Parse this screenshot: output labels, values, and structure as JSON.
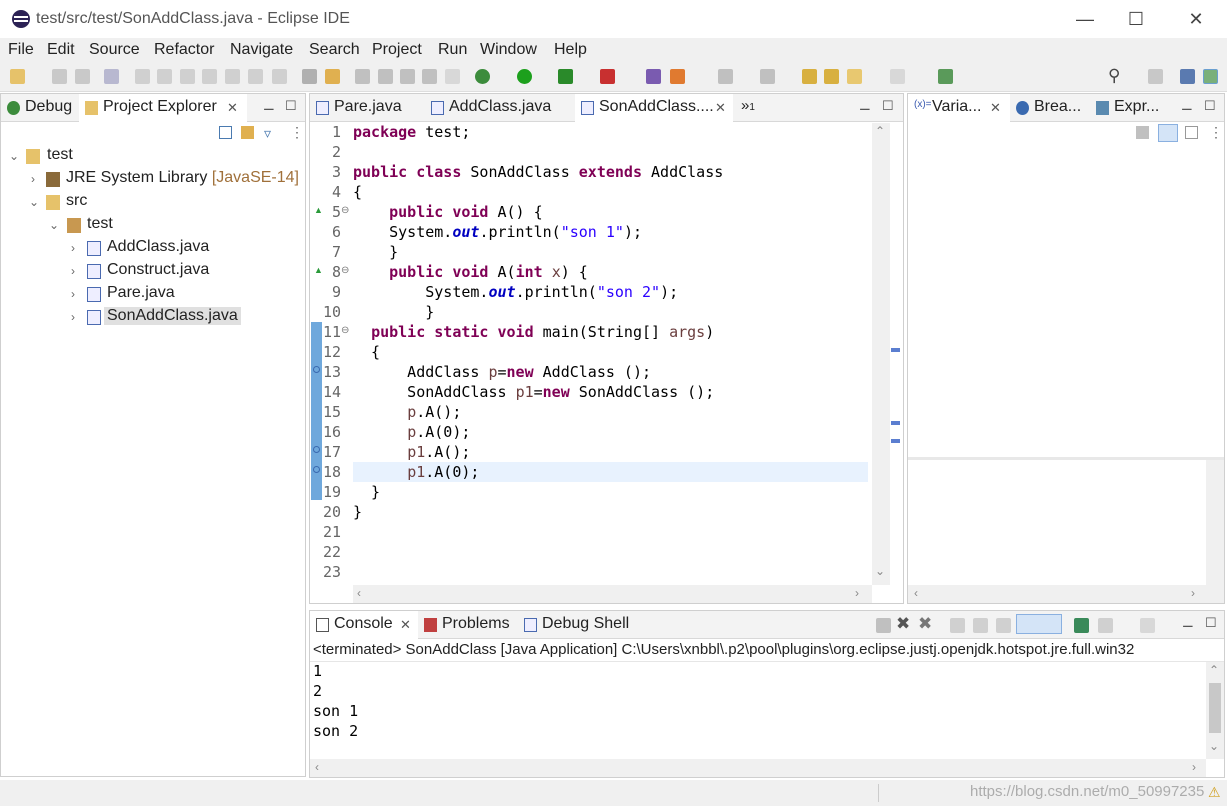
{
  "window": {
    "title": "test/src/test/SonAddClass.java - Eclipse IDE",
    "minimize": "—",
    "maximize": "☐",
    "close": "✕"
  },
  "menu": [
    "File",
    "Edit",
    "Source",
    "Refactor",
    "Navigate",
    "Search",
    "Project",
    "Run",
    "Window",
    "Help"
  ],
  "left_panel": {
    "tabs": [
      {
        "label": "Debug"
      },
      {
        "label": "Project Explorer",
        "close": "✕"
      }
    ],
    "tree": [
      {
        "label": "test",
        "deco": ""
      },
      {
        "label": "JRE System Library",
        "deco": "[JavaSE-14]"
      },
      {
        "label": "src",
        "deco": ""
      },
      {
        "label": "test",
        "deco": ""
      },
      {
        "label": "AddClass.java",
        "deco": ""
      },
      {
        "label": "Construct.java",
        "deco": ""
      },
      {
        "label": "Pare.java",
        "deco": ""
      },
      {
        "label": "SonAddClass.java",
        "deco": ""
      }
    ]
  },
  "editor": {
    "tabs": [
      {
        "label": "Pare.java"
      },
      {
        "label": "AddClass.java"
      },
      {
        "label": "SonAddClass...."
      }
    ],
    "overflow": "»",
    "overflow_count": "1",
    "line_numbers": [
      "1",
      "2",
      "3",
      "4",
      "5",
      "6",
      "7",
      "8",
      "9",
      "10",
      "11",
      "12",
      "13",
      "14",
      "15",
      "16",
      "17",
      "18",
      "19",
      "20",
      "21",
      "22",
      "23"
    ],
    "current_line": 18
  },
  "right_panel": {
    "tabs": [
      {
        "label": "Varia..."
      },
      {
        "label": "Brea..."
      },
      {
        "label": "Expr..."
      }
    ]
  },
  "console": {
    "tabs": [
      {
        "label": "Console"
      },
      {
        "label": "Problems"
      },
      {
        "label": "Debug Shell"
      }
    ],
    "header": "<terminated> SonAddClass [Java Application] C:\\Users\\xnbbl\\.p2\\pool\\plugins\\org.eclipse.justj.openjdk.hotspot.jre.full.win32",
    "output": [
      "1",
      "2",
      "son 1",
      "son 2"
    ]
  },
  "watermark": "https://blog.csdn.net/m0_50997235",
  "colors": {
    "keyword": "#7f0055",
    "string": "#2a00ff",
    "field": "#0000c0",
    "line_highlight": "#e8f2fe",
    "gutter_marker": "#5b9bd5"
  }
}
